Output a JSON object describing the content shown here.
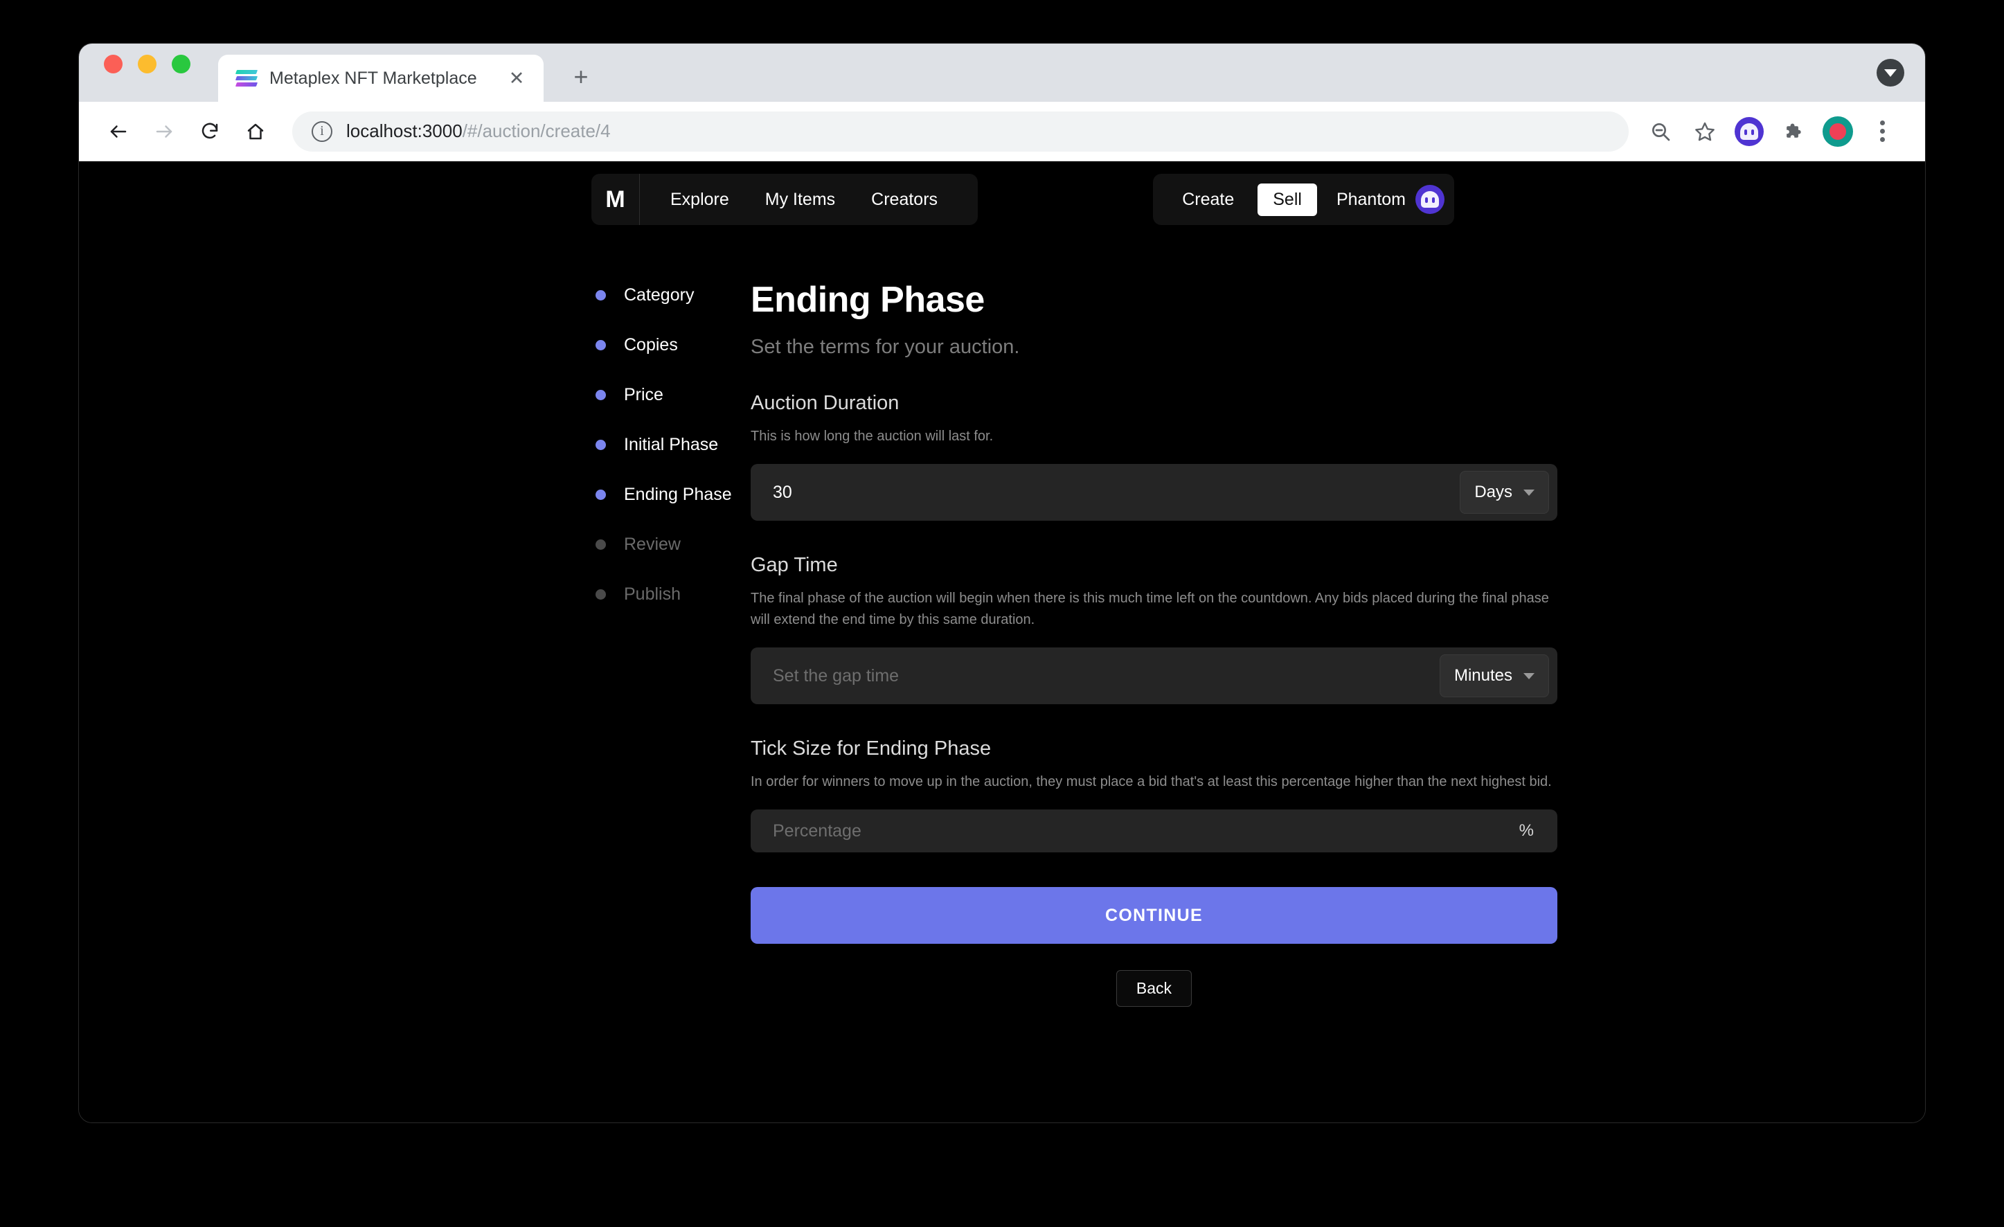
{
  "browser": {
    "tab": {
      "title": "Metaplex NFT Marketplace",
      "favicon": "solana-logo-icon",
      "close_label": "✕"
    },
    "new_tab_label": "+",
    "url_host": "localhost:3000",
    "url_path": "/#/auction/create/4",
    "toolbar_icons": [
      "back-icon",
      "forward-icon",
      "reload-icon",
      "home-icon",
      "zoom-out-icon",
      "bookmark-star-icon",
      "phantom-extension-icon",
      "extensions-puzzle-icon",
      "profile-avatar-icon",
      "chrome-menu-icon"
    ]
  },
  "app": {
    "logo": "M",
    "nav": [
      {
        "label": "Explore"
      },
      {
        "label": "My Items"
      },
      {
        "label": "Creators"
      }
    ],
    "actions": {
      "create_label": "Create",
      "sell_label": "Sell",
      "wallet_label": "Phantom",
      "wallet_icon": "phantom-ghost-icon"
    },
    "accent_color": "#6c76ea",
    "step_active_color": "#7b85ee",
    "step_inactive_color": "#4a4a4a"
  },
  "steps": [
    {
      "label": "Category",
      "state": "active"
    },
    {
      "label": "Copies",
      "state": "active"
    },
    {
      "label": "Price",
      "state": "active"
    },
    {
      "label": "Initial Phase",
      "state": "active"
    },
    {
      "label": "Ending Phase",
      "state": "active"
    },
    {
      "label": "Review",
      "state": "inactive"
    },
    {
      "label": "Publish",
      "state": "inactive"
    }
  ],
  "main": {
    "title": "Ending Phase",
    "subtitle": "Set the terms for your auction.",
    "sections": [
      {
        "title": "Auction Duration",
        "description": "This is how long the auction will last for.",
        "value": "30",
        "placeholder": "",
        "unit": "Days"
      },
      {
        "title": "Gap Time",
        "description": "The final phase of the auction will begin when there is this much time left on the countdown. Any bids placed during the final phase will extend the end time by this same duration.",
        "value": "",
        "placeholder": "Set the gap time",
        "unit": "Minutes"
      },
      {
        "title": "Tick Size for Ending Phase",
        "description": "In order for winners to move up in the auction, they must place a bid that's at least this percentage higher than the next highest bid.",
        "value": "",
        "placeholder": "Percentage",
        "suffix": "%"
      }
    ],
    "continue_label": "CONTINUE",
    "back_label": "Back"
  }
}
